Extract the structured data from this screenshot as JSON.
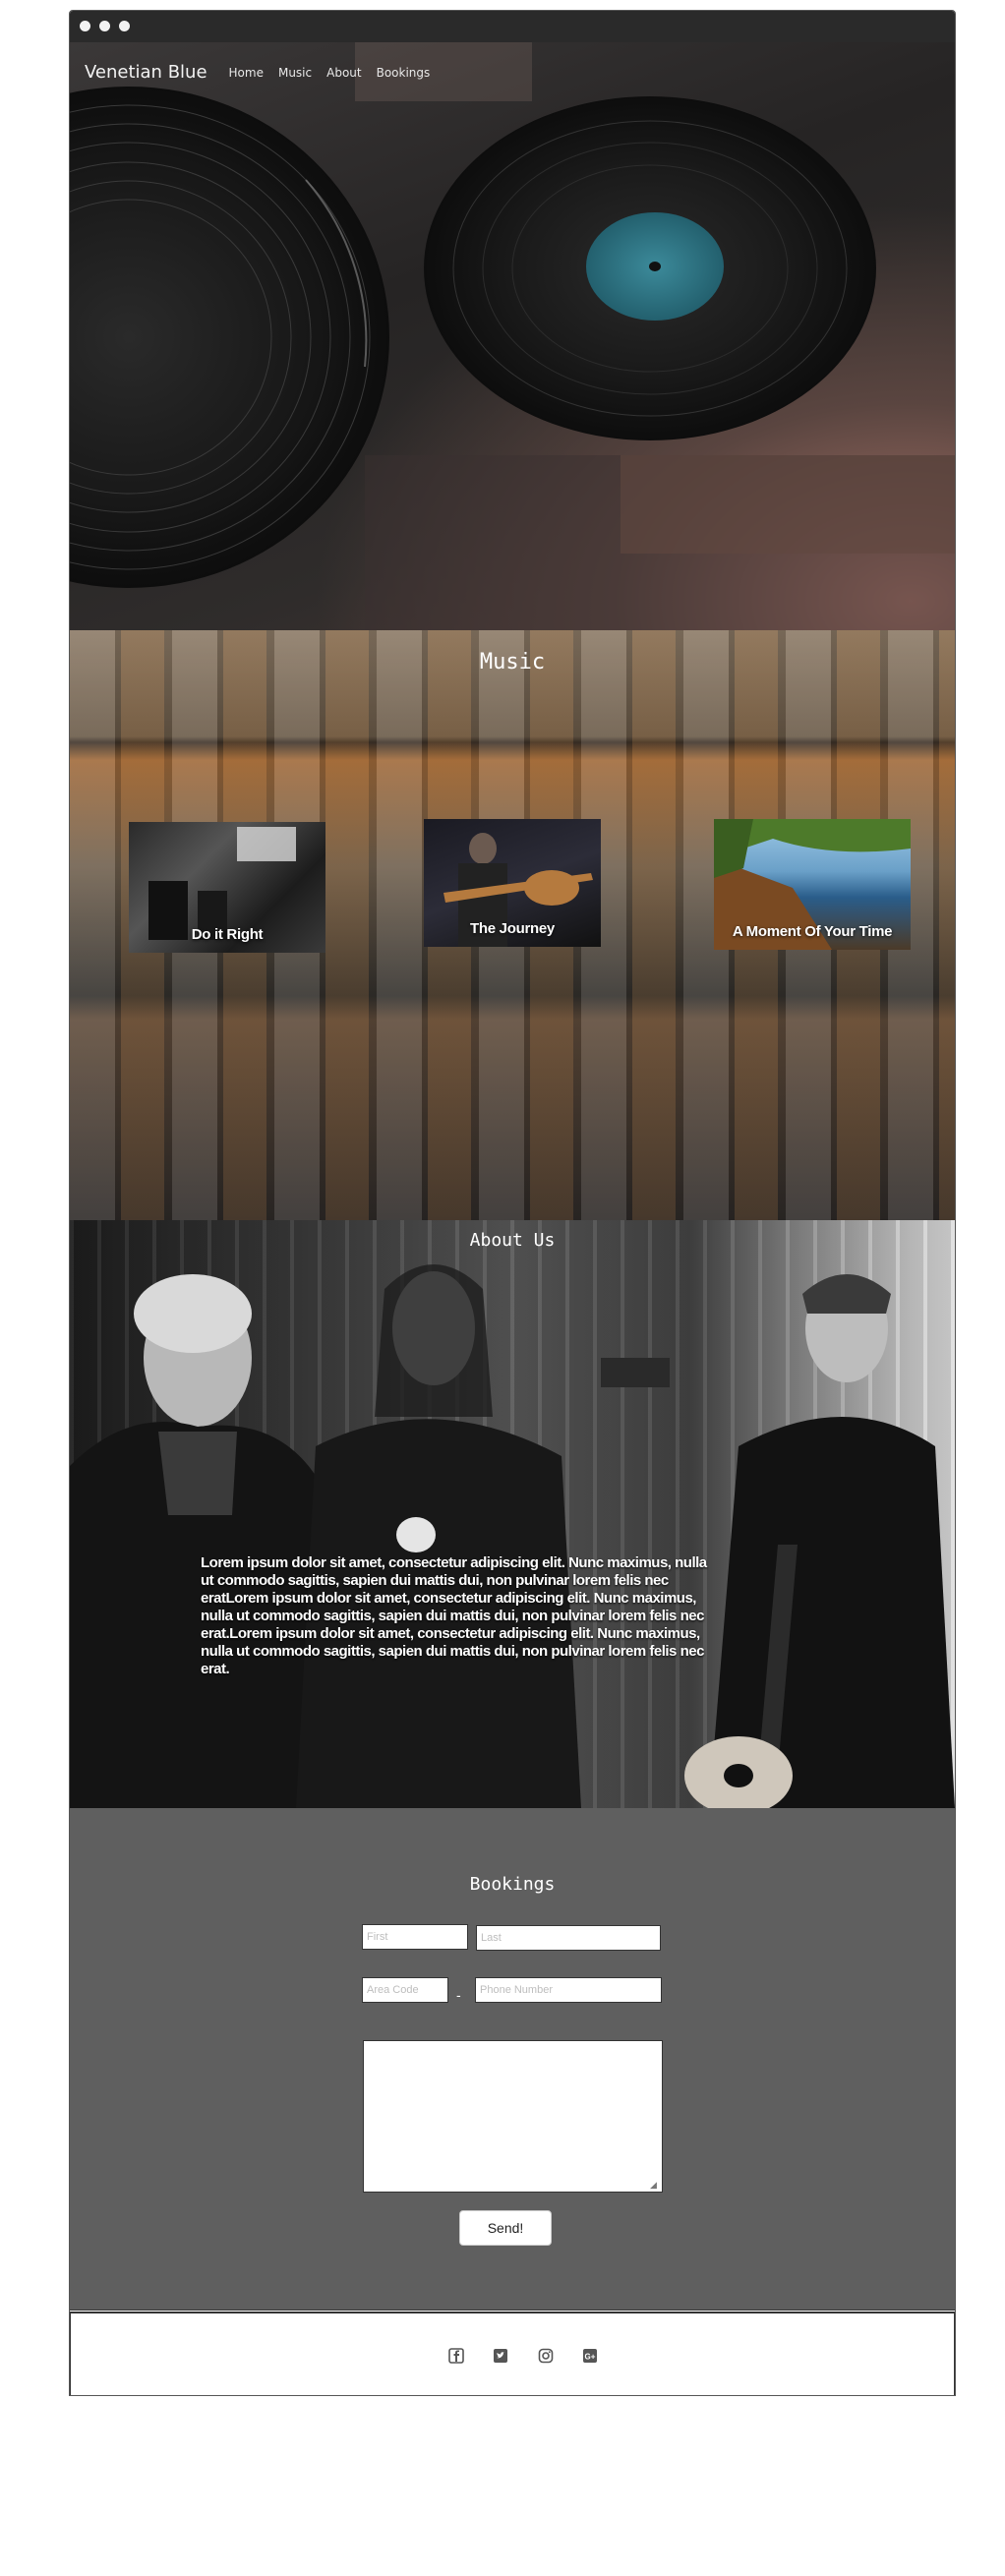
{
  "nav": {
    "brand": "Venetian Blue",
    "links": [
      "Home",
      "Music",
      "About",
      "Bookings"
    ]
  },
  "music": {
    "title": "Music",
    "cards": [
      {
        "caption": "Do it Right"
      },
      {
        "caption": "The Journey"
      },
      {
        "caption": "A Moment Of Your Time"
      }
    ]
  },
  "about": {
    "title": "About Us",
    "text": "Lorem ipsum dolor sit amet, consectetur adipiscing elit. Nunc maximus, nulla ut commodo sagittis, sapien dui mattis dui, non pulvinar lorem felis nec eratLorem ipsum dolor sit amet, consectetur adipiscing elit. Nunc maximus, nulla ut commodo sagittis, sapien dui mattis dui, non pulvinar lorem felis nec erat.Lorem ipsum dolor sit amet, consectetur adipiscing elit. Nunc maximus, nulla ut commodo sagittis, sapien dui mattis dui, non pulvinar lorem felis nec erat."
  },
  "bookings": {
    "title": "Bookings",
    "first_placeholder": "First",
    "last_placeholder": "Last",
    "area_placeholder": "Area Code",
    "phone_placeholder": "Phone Number",
    "dash": "-",
    "send_label": "Send!"
  },
  "footer": {
    "icons": [
      "facebook-icon",
      "twitter-icon",
      "instagram-icon",
      "google-plus-icon"
    ]
  },
  "colors": {
    "titlebar": "#2a2a2a",
    "bookings_bg": "#5f5f5f",
    "text_light": "#ffffff"
  }
}
